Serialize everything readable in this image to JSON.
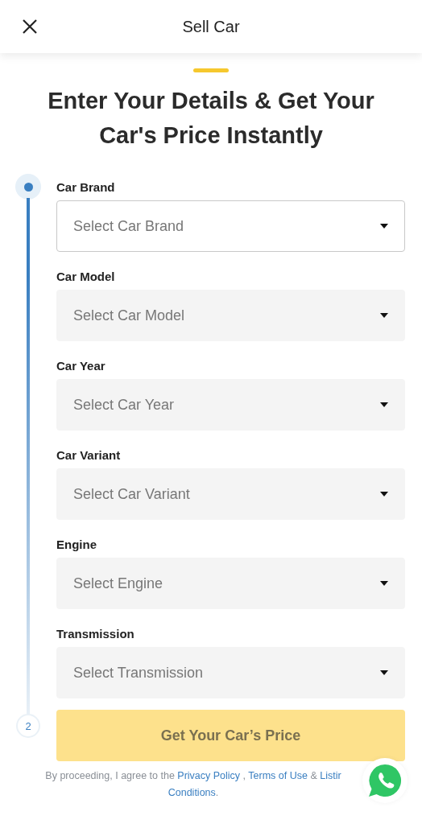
{
  "header": {
    "title": "Sell Car"
  },
  "heading": "Enter Your Details & Get Your Car's Price Instantly",
  "steps": [
    {
      "label": "Car Brand",
      "placeholder": "Select Car Brand",
      "active": true
    },
    {
      "label": "Car Model",
      "placeholder": "Select Car Model",
      "active": false
    },
    {
      "label": "Car Year",
      "placeholder": "Select Car Year",
      "active": false
    },
    {
      "label": "Car Variant",
      "placeholder": "Select Car Variant",
      "active": false
    },
    {
      "label": "Engine",
      "placeholder": "Select Engine",
      "active": false
    },
    {
      "label": "Transmission",
      "placeholder": "Select Transmission",
      "active": false
    }
  ],
  "next_step": "2",
  "submit": {
    "label": "Get Your Car’s Price",
    "disabled": true
  },
  "footer": [
    {
      "kind": "text",
      "text": "By proceeding, I agree to the "
    },
    {
      "kind": "link",
      "text": "Privacy Policy"
    },
    {
      "kind": "text",
      "text": " , "
    },
    {
      "kind": "link",
      "text": "Terms of Use"
    },
    {
      "kind": "text",
      "text": " & "
    },
    {
      "kind": "link",
      "text": "Listir"
    },
    {
      "kind": "break"
    },
    {
      "kind": "link",
      "text": "Conditions"
    },
    {
      "kind": "text",
      "text": "."
    }
  ]
}
